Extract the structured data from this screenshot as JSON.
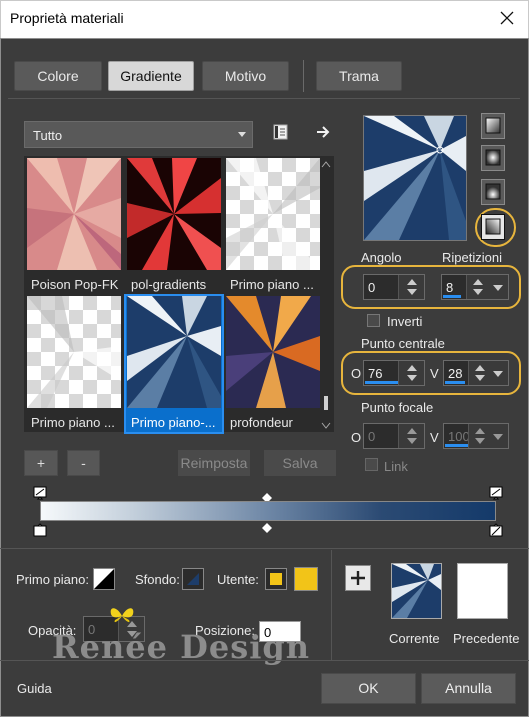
{
  "window": {
    "title": "Proprietà materiali"
  },
  "tabs": [
    {
      "label": "Colore",
      "active": false
    },
    {
      "label": "Gradiente",
      "active": true
    },
    {
      "label": "Motivo",
      "active": false
    },
    {
      "label": "Trama",
      "active": false
    }
  ],
  "category": {
    "selected": "Tutto"
  },
  "gradients": [
    {
      "label": "Poison Pop-FK",
      "selected": false
    },
    {
      "label": "pol-gradients",
      "selected": false
    },
    {
      "label": "Primo piano ...",
      "selected": false
    },
    {
      "label": "Primo piano ...",
      "selected": false
    },
    {
      "label": "Primo piano-...",
      "selected": true
    },
    {
      "label": "profondeur",
      "selected": false
    }
  ],
  "buttons": {
    "add": "+",
    "remove": "-",
    "reset": "Reimposta",
    "save": "Salva"
  },
  "settings": {
    "angle_label": "Angolo",
    "angle_value": "0",
    "repeat_label": "Ripetizioni",
    "repeat_value": "8",
    "invert_label": "Inverti",
    "invert_checked": false,
    "center_label": "Punto centrale",
    "h_prefix": "O",
    "v_prefix": "V",
    "center_h": "76",
    "center_v": "28",
    "focal_label": "Punto focale",
    "focal_h": "0",
    "focal_v": "100",
    "link_label": "Link",
    "link_checked": false
  },
  "bottom": {
    "foreground_label": "Primo piano:",
    "background_label": "Sfondo:",
    "user_label": "Utente:",
    "opacity_label": "Opacità:",
    "opacity_value": "0",
    "position_label": "Posizione:",
    "position_value": "0",
    "current_label": "Corrente",
    "previous_label": "Precedente",
    "user_color": "#f2c418"
  },
  "watermark": "Renée Design",
  "footer": {
    "help": "Guida",
    "ok": "OK",
    "cancel": "Annulla"
  }
}
